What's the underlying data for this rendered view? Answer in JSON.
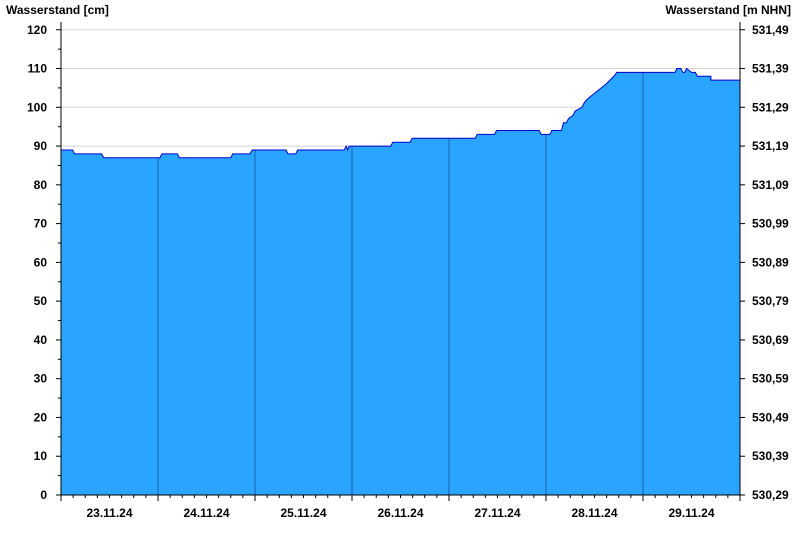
{
  "chart_data": {
    "type": "area",
    "left_axis_label": "Wasserstand [cm]",
    "right_axis_label": "Wasserstand [m NHN]",
    "y_left_ticks": [
      "0",
      "10",
      "20",
      "30",
      "40",
      "50",
      "60",
      "70",
      "80",
      "90",
      "100",
      "110",
      "120"
    ],
    "y_right_ticks": [
      "530,29",
      "530,39",
      "530,49",
      "530,59",
      "530,69",
      "530,79",
      "530,89",
      "530,99",
      "531,09",
      "531,19",
      "531,29",
      "531,39",
      "531,49"
    ],
    "ylim": [
      0,
      122
    ],
    "y_right_range": [
      530.29,
      531.51
    ],
    "x_labels": [
      "23.11.24",
      "24.11.24",
      "25.11.24",
      "26.11.24",
      "27.11.24",
      "28.11.24",
      "29.11.24"
    ],
    "xlim_days": [
      22.0,
      29.0
    ],
    "fill_color": "#2aa5ff",
    "line_color": "#0000cc",
    "grid": "horizontal",
    "series": [
      {
        "x": [
          22.0,
          22.12,
          22.14,
          22.42,
          22.44,
          23.02,
          23.04,
          23.2,
          23.22,
          23.75,
          23.77,
          23.95,
          23.97,
          24.32,
          24.34,
          24.42,
          24.44,
          24.92,
          24.94,
          24.955,
          24.97,
          25.4,
          25.42,
          25.6,
          25.62,
          26.0,
          26.27,
          26.29,
          26.47,
          26.49,
          26.93,
          26.95,
          27.04,
          27.06,
          27.16,
          27.18,
          27.21,
          27.23,
          27.28,
          27.3,
          27.37,
          27.39,
          27.42,
          27.47,
          27.52,
          27.57,
          27.62,
          27.66,
          27.7,
          27.73,
          27.75,
          28.0,
          28.33,
          28.35,
          28.39,
          28.41,
          28.43,
          28.45,
          28.5,
          28.52,
          28.54,
          28.56,
          28.6,
          28.62,
          28.7,
          28.7,
          29.0
        ],
        "y": [
          89,
          89,
          88,
          88,
          87,
          87,
          88,
          88,
          87,
          87,
          88,
          88,
          89,
          89,
          88,
          88,
          89,
          89,
          90,
          89,
          90,
          90,
          91,
          91,
          92,
          92,
          92,
          93,
          93,
          94,
          94,
          93,
          93,
          94,
          94,
          96,
          96,
          97,
          98,
          99,
          100,
          101,
          102,
          103,
          104,
          105,
          106,
          107,
          108,
          109,
          109,
          109,
          109,
          110,
          110,
          109,
          109,
          110,
          109,
          109,
          109,
          108,
          108,
          108,
          108,
          107,
          107
        ]
      }
    ]
  }
}
